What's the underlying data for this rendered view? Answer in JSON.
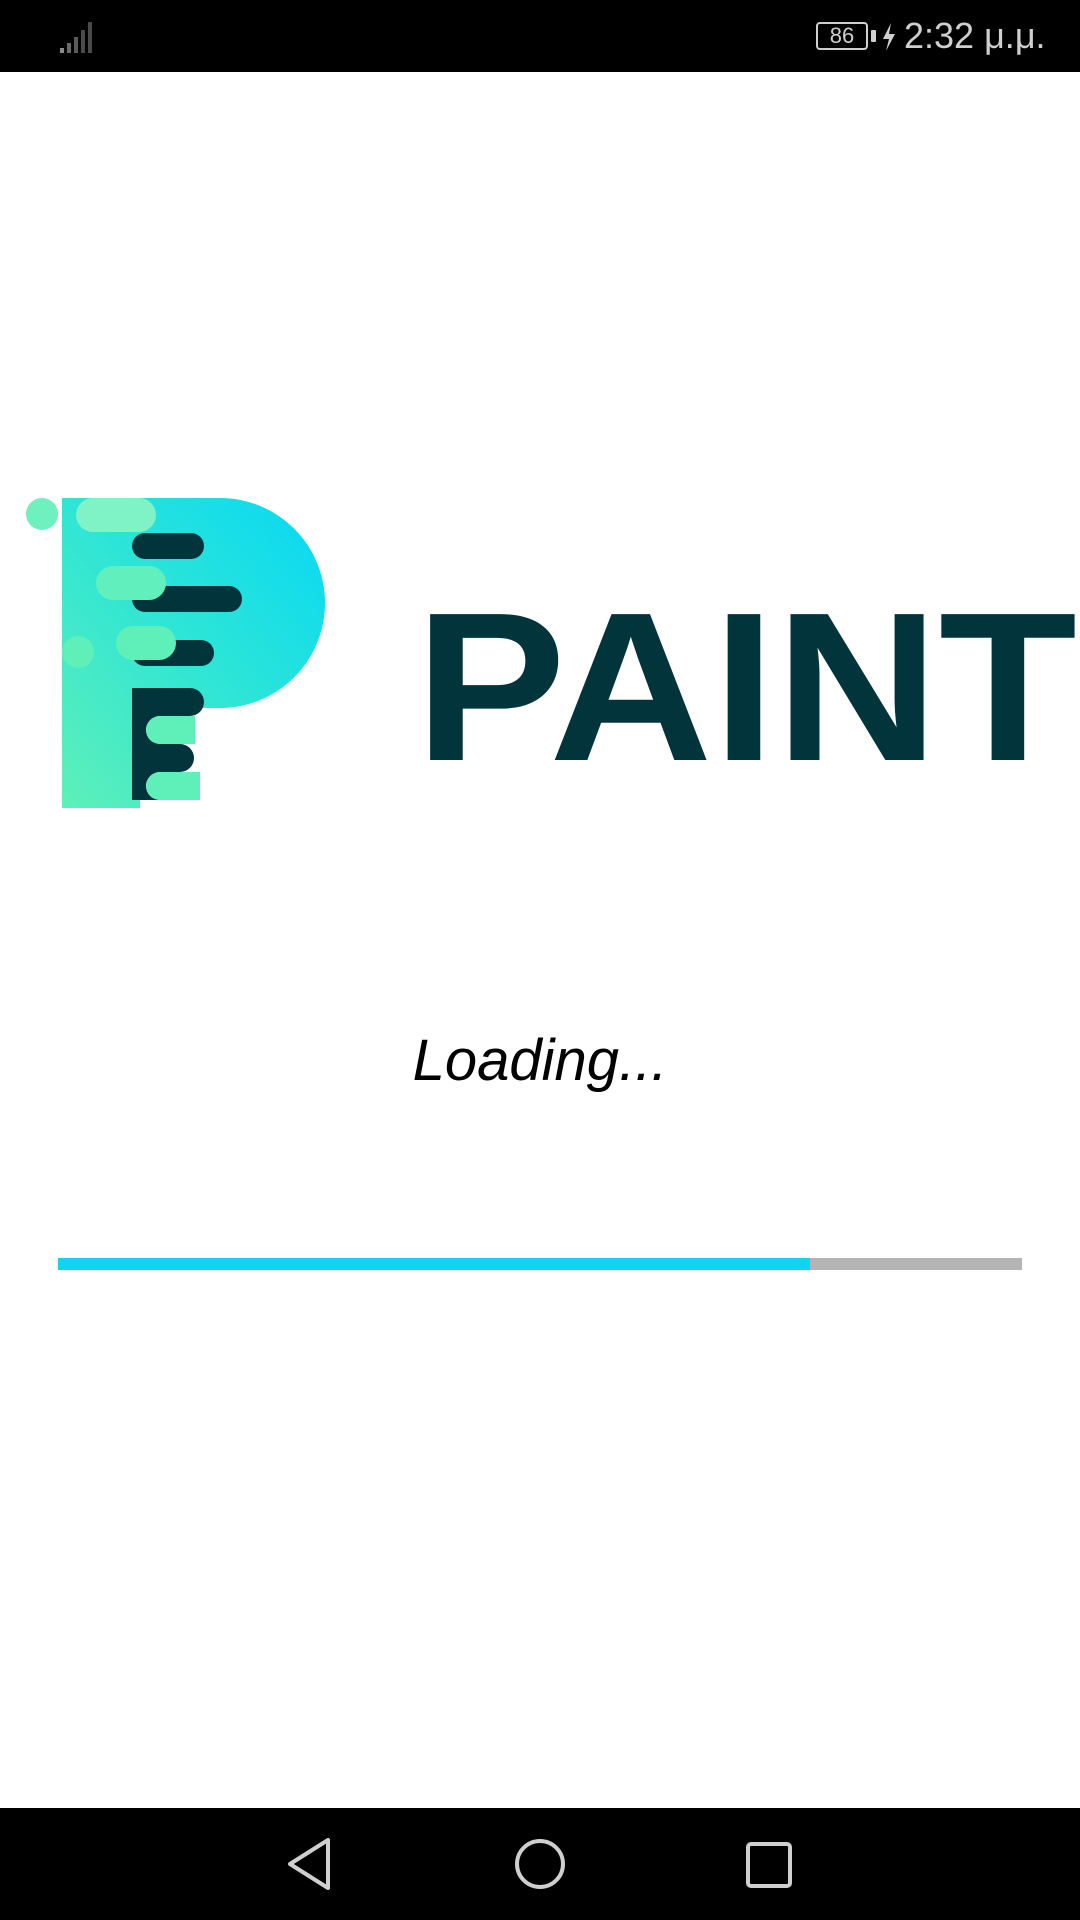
{
  "status_bar": {
    "battery_level": "86",
    "time": "2:32 μ.μ.",
    "signal_icon": "signal-icon",
    "charging_icon": "charging-icon"
  },
  "logo": {
    "text": "PAINT",
    "colors": {
      "dark": "#02343c",
      "cyan": "#07d8f6",
      "mint": "#5ef0b8"
    }
  },
  "loading": {
    "text": "Loading...",
    "progress": 0.78,
    "fill_color": "#12d3f2",
    "track_color": "#b4b4b4"
  },
  "nav_bar": {
    "back_icon": "back-triangle-icon",
    "home_icon": "home-circle-icon",
    "recents_icon": "recents-square-icon"
  }
}
